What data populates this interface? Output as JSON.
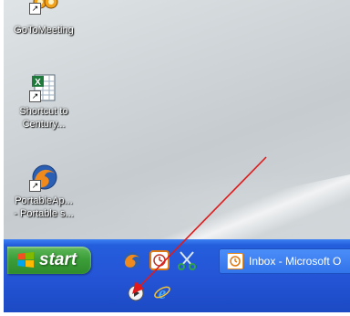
{
  "desktop": {
    "icons": [
      {
        "label": "GoToMeeting"
      },
      {
        "label": "Shortcut to\nCentury..."
      },
      {
        "label": "PortableAp...\n- Portable s..."
      }
    ]
  },
  "taskbar": {
    "start_label": "start",
    "quick_launch": [
      "firefox-icon",
      "clock-icon",
      "scissors-icon"
    ],
    "tasks": [
      {
        "label": "Inbox - Microsoft O"
      }
    ],
    "second_row": [
      "media-player-icon",
      "internet-explorer-icon"
    ]
  },
  "colors": {
    "taskbar_blue": "#245edc",
    "start_green": "#3c9e39",
    "annotation_arrow": "#e01a1a"
  }
}
